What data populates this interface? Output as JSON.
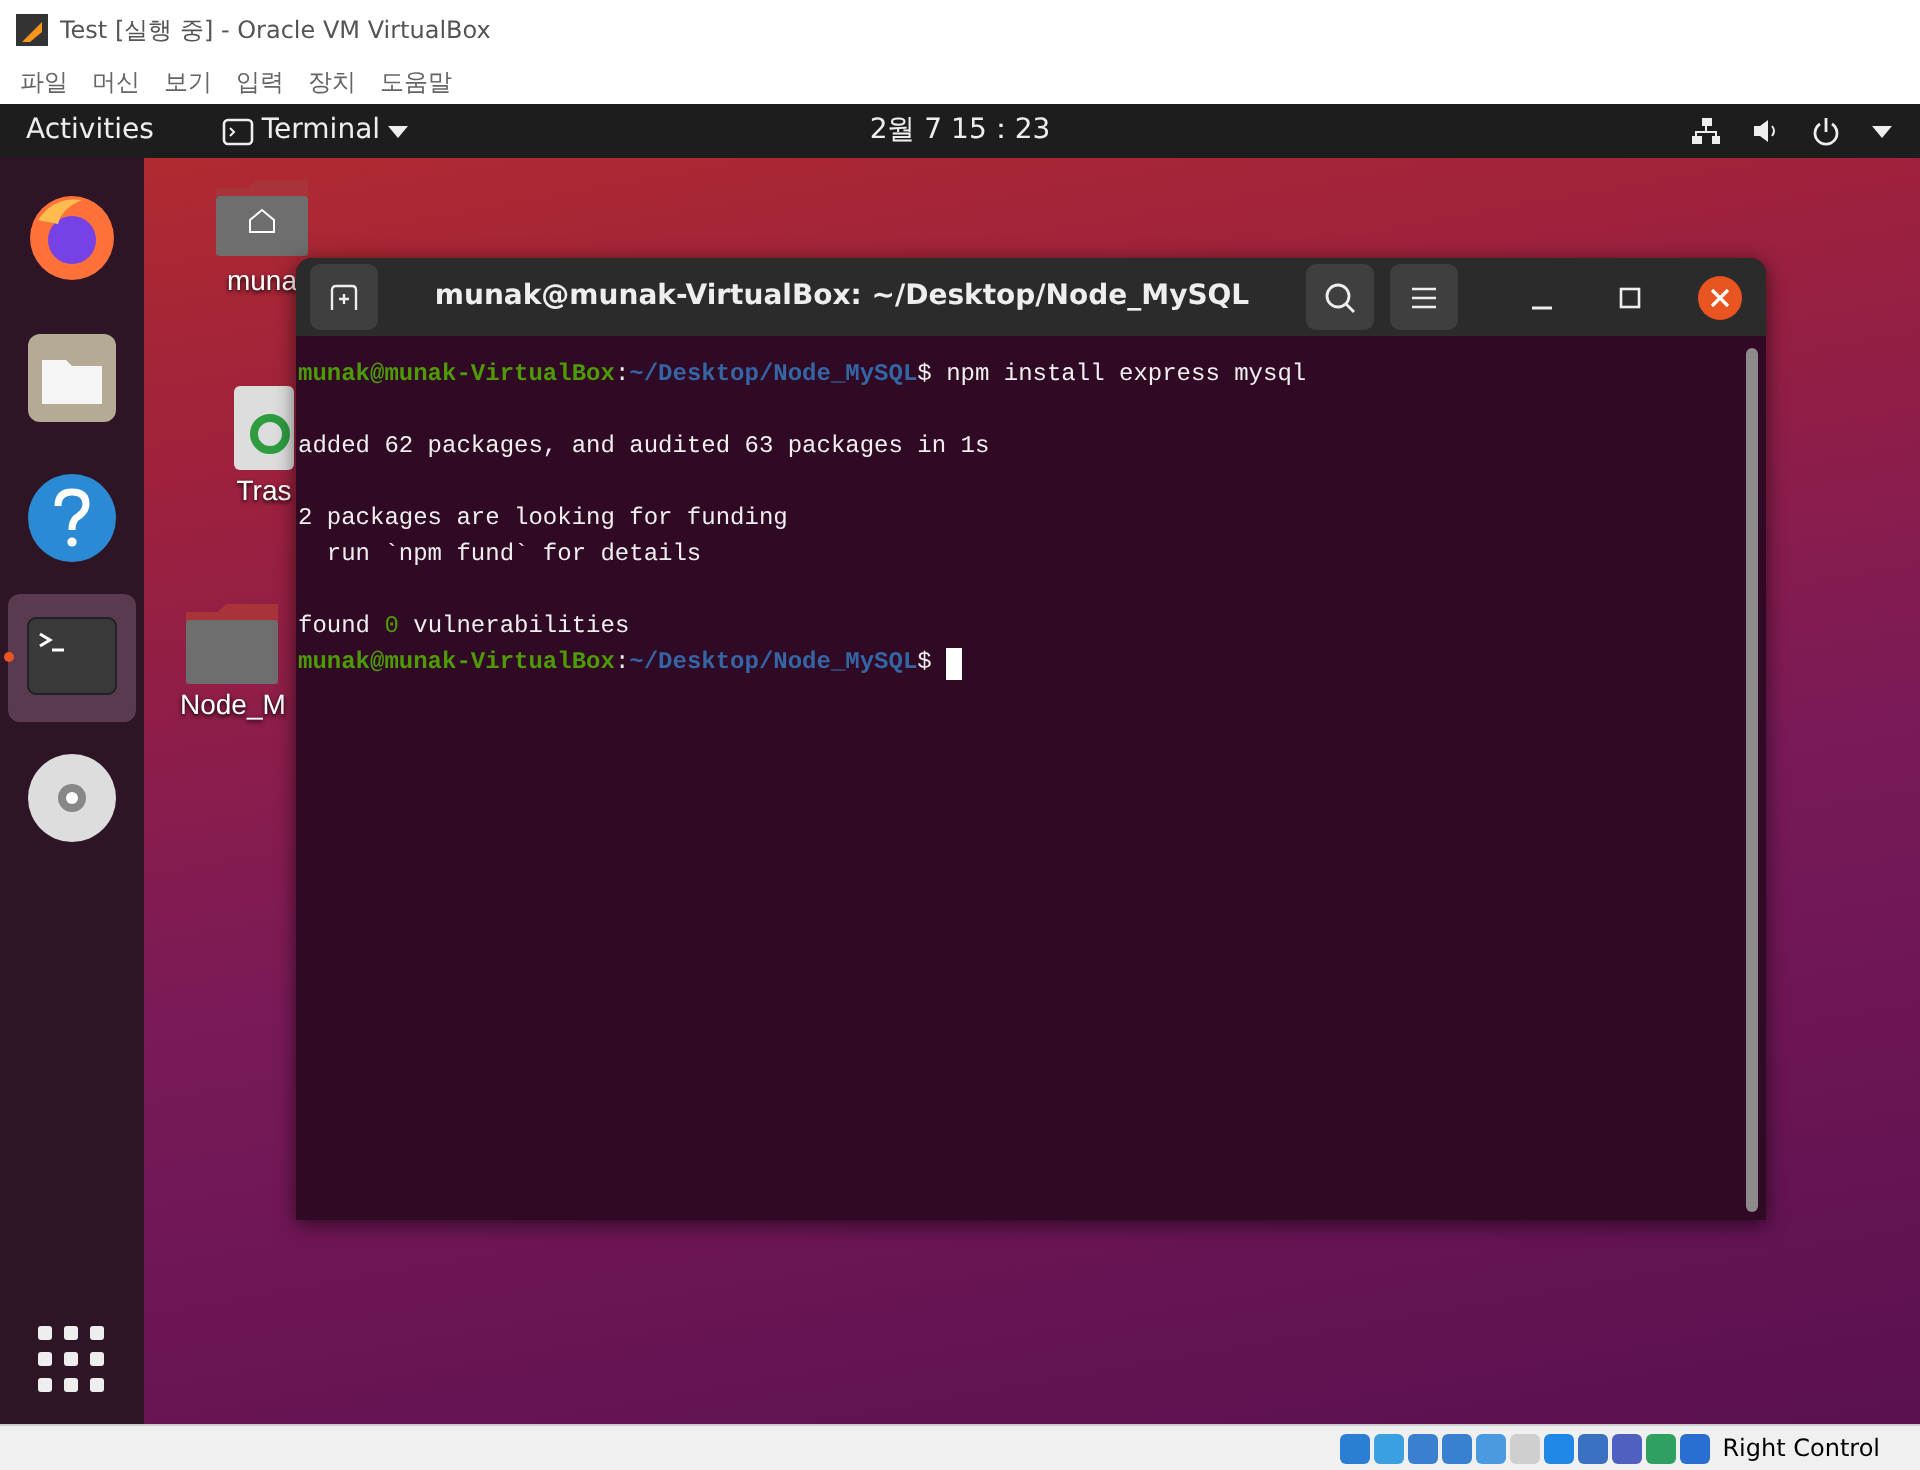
{
  "window": {
    "title": "Test [실행 중] - Oracle VM VirtualBox"
  },
  "menu": [
    "파일",
    "머신",
    "보기",
    "입력",
    "장치",
    "도움말"
  ],
  "top_bar": {
    "activities": "Activities",
    "app_menu": "Terminal",
    "clock": "2월 7  15：23"
  },
  "dock": [
    {
      "kind": "firefox",
      "selected": false,
      "running": false
    },
    {
      "kind": "files",
      "selected": false,
      "running": false
    },
    {
      "kind": "help",
      "selected": false,
      "running": false
    },
    {
      "kind": "terminal",
      "selected": true,
      "running": true
    },
    {
      "kind": "disc",
      "selected": false,
      "running": false
    }
  ],
  "desktop_icons": [
    {
      "kind": "home",
      "label": "muna"
    },
    {
      "kind": "trash",
      "label": "Tras"
    },
    {
      "kind": "folder",
      "label": "Node_M"
    }
  ],
  "terminal": {
    "title": "munak@munak-VirtualBox: ~/Desktop/Node_MySQL",
    "cursor": true,
    "paragraphs": [
      [
        [
          {
            "kind": "user",
            "text": "munak@munak-VirtualBox"
          },
          {
            "kind": "plain",
            "text": ":"
          },
          {
            "kind": "path",
            "text": "~/Desktop/Node_MySQL"
          },
          {
            "kind": "plain",
            "text": "$ npm install express mysql"
          }
        ]
      ],
      [
        [
          {
            "kind": "plain",
            "text": "added 62 packages, and audited 63 packages in 1s"
          }
        ]
      ],
      [
        [
          {
            "kind": "plain",
            "text": "2 packages are looking for funding"
          }
        ],
        [
          {
            "kind": "plain",
            "text": "  run `npm fund` for details"
          }
        ]
      ],
      [
        [
          {
            "kind": "plain",
            "text": "found "
          },
          {
            "kind": "number",
            "text": "0"
          },
          {
            "kind": "plain",
            "text": " vulnerabilities"
          }
        ],
        [
          {
            "kind": "user",
            "text": "munak@munak-VirtualBox"
          },
          {
            "kind": "plain",
            "text": ":"
          },
          {
            "kind": "path",
            "text": "~/Desktop/Node_MySQL"
          },
          {
            "kind": "plain",
            "text": "$ "
          }
        ]
      ]
    ]
  },
  "status_bar": {
    "host_key": "Right Control"
  }
}
